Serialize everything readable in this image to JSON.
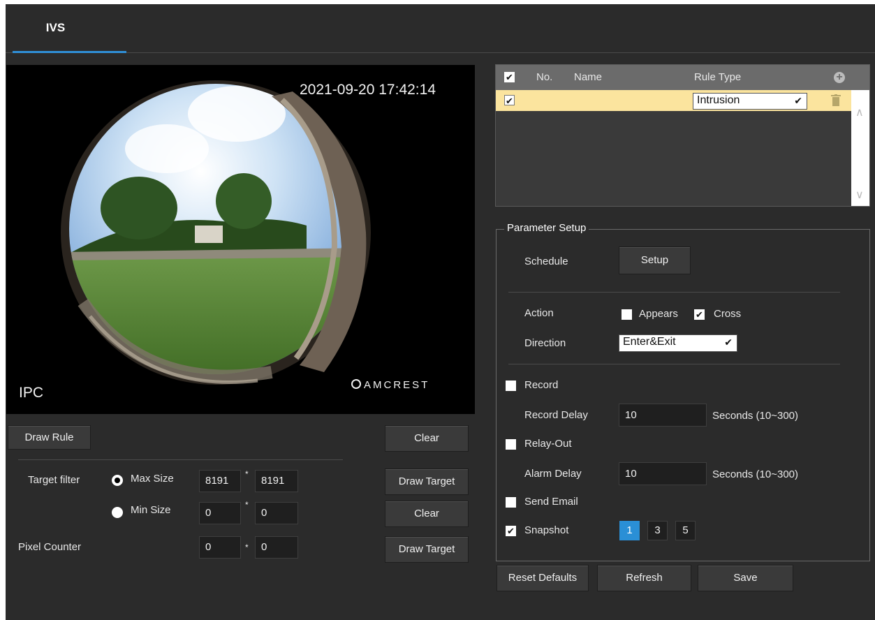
{
  "tab": {
    "label": "IVS"
  },
  "video": {
    "timestamp": "2021-09-20 17:42:14",
    "channel": "IPC",
    "brand": "AMCREST"
  },
  "left": {
    "draw_rule": "Draw Rule",
    "clear_top": "Clear",
    "target_filter": "Target filter",
    "max_size": "Max Size",
    "min_size": "Min Size",
    "max_w": "8191",
    "max_h": "8191",
    "min_w": "0",
    "min_h": "0",
    "draw_target_1": "Draw Target",
    "clear_mid": "Clear",
    "pixel_counter": "Pixel Counter",
    "pc_w": "0",
    "pc_h": "0",
    "draw_target_2": "Draw Target",
    "star": "*"
  },
  "rules": {
    "headers": {
      "no": "No.",
      "name": "Name",
      "rule_type": "Rule Type"
    },
    "rows": [
      {
        "rule_type": "Intrusion"
      }
    ]
  },
  "params": {
    "legend": "Parameter Setup",
    "schedule": "Schedule",
    "setup": "Setup",
    "action": "Action",
    "appears": "Appears",
    "cross": "Cross",
    "direction": "Direction",
    "direction_value": "Enter&Exit",
    "record": "Record",
    "record_delay": "Record Delay",
    "record_delay_value": "10",
    "record_delay_unit": "Seconds (10~300)",
    "relay_out": "Relay-Out",
    "alarm_delay": "Alarm Delay",
    "alarm_delay_value": "10",
    "alarm_delay_unit": "Seconds (10~300)",
    "send_email": "Send Email",
    "snapshot": "Snapshot",
    "snap_1": "1",
    "snap_3": "3",
    "snap_5": "5"
  },
  "footer": {
    "reset": "Reset Defaults",
    "refresh": "Refresh",
    "save": "Save"
  },
  "colors": {
    "accent": "#2f8fd8",
    "panel": "#2b2b2b",
    "row_highlight": "#fbe49e"
  }
}
